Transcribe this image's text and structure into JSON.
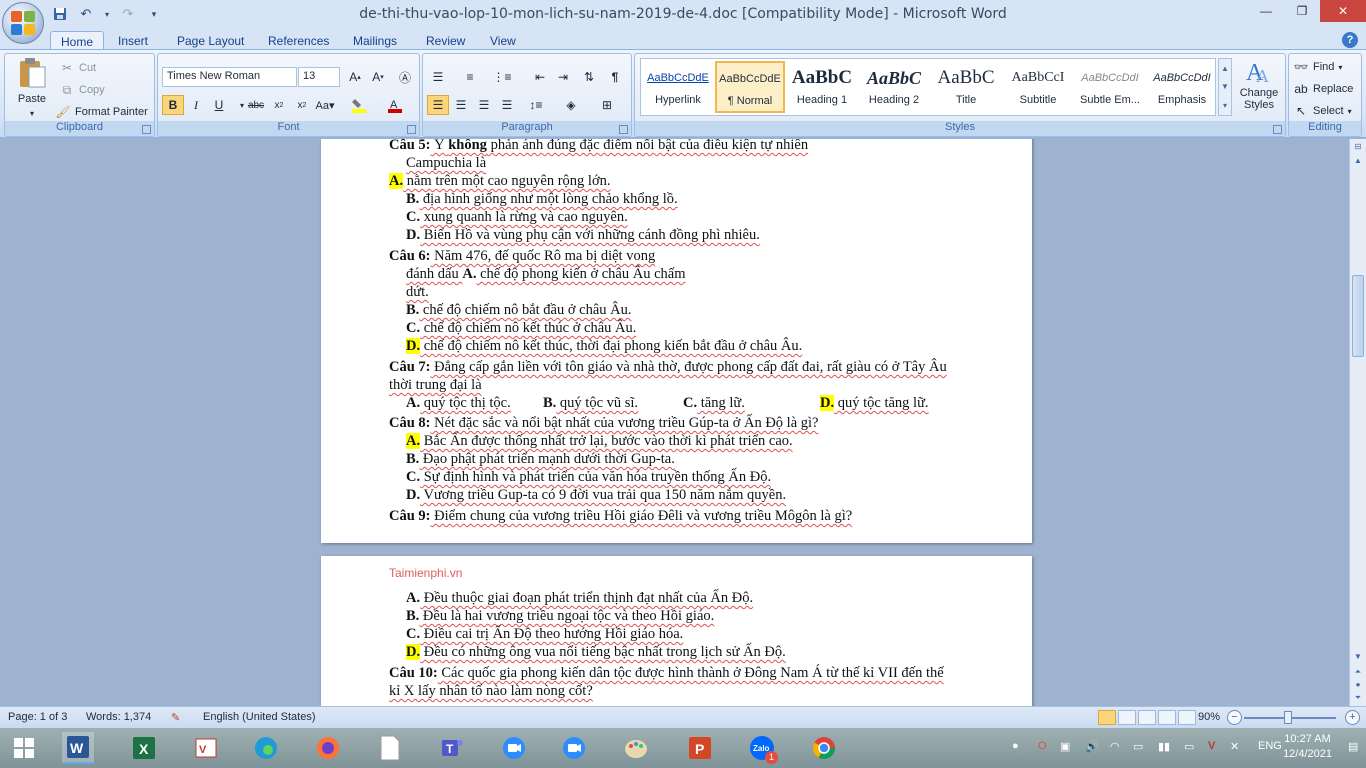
{
  "window": {
    "title": "de-thi-thu-vao-lop-10-mon-lich-su-nam-2019-de-4.doc [Compatibility Mode] - Microsoft Word"
  },
  "tabs": [
    "Home",
    "Insert",
    "Page Layout",
    "References",
    "Mailings",
    "Review",
    "View"
  ],
  "ribbon": {
    "clipboard": {
      "paste": "Paste",
      "cut": "Cut",
      "copy": "Copy",
      "format_painter": "Format Painter",
      "label": "Clipboard"
    },
    "font": {
      "name": "Times New Roman",
      "size": "13",
      "label": "Font"
    },
    "paragraph": {
      "label": "Paragraph"
    },
    "styles": {
      "label": "Styles",
      "items": [
        {
          "sample": "AaBbCcDdE",
          "name": "Hyperlink"
        },
        {
          "sample": "AaBbCcDdE",
          "name": "¶ Normal"
        },
        {
          "sample": "AaBbC",
          "name": "Heading 1"
        },
        {
          "sample": "AaBbC",
          "name": "Heading 2"
        },
        {
          "sample": "AaBbC",
          "name": "Title"
        },
        {
          "sample": "AaBbCcI",
          "name": "Subtitle"
        },
        {
          "sample": "AaBbCcDdI",
          "name": "Subtle Em..."
        },
        {
          "sample": "AaBbCcDdI",
          "name": "Emphasis"
        }
      ],
      "change_styles": "Change Styles"
    },
    "editing": {
      "find": "Find",
      "replace": "Replace",
      "select": "Select",
      "label": "Editing"
    }
  },
  "document": {
    "watermark": "Taimienphi.vn",
    "q5": {
      "num": "Câu 5:",
      "pre": " Ý ",
      "bold": "không",
      "post": " phản ánh đúng đặc điểm nổi bật của điều kiện tự nhiên",
      "line2": "Campuchia là",
      "a_lab": "A.",
      "a": " nằm trên một cao nguyên rộng lớn.",
      "b_lab": "B.",
      "b": " địa hình giống như một lòng chảo khổng lồ.",
      "c_lab": "C.",
      "c": " xung quanh là rừng và cao nguyên.",
      "d_lab": "D.",
      "d": " Biển Hồ và vùng phụ cận với những cánh đồng phì nhiêu."
    },
    "q6": {
      "num": "Câu 6:",
      "text": " Năm 476, đế quốc Rô ma bị diệt vong",
      "a_pre": "đánh dấu ",
      "a_lab": "A.",
      "a": " chế độ phong kiến ở châu Âu chấm",
      "a2": "dứt.",
      "b_lab": "B.",
      "b": " chế độ chiếm nô bắt đầu ở châu Âu.",
      "c_lab": "C.",
      "c": " chế độ chiếm nô kết thúc ở châu Âu.",
      "d_lab": "D.",
      "d": " chế độ chiếm nô kết thúc, thời đại phong kiến bắt đầu ở châu Âu."
    },
    "q7": {
      "num": "Câu 7:",
      "text": " Đẳng cấp gắn liền với tôn giáo và nhà thờ, được phong cấp đất đai, rất giàu có ở Tây Âu",
      "line2": "thời trung đại là",
      "a_lab": "A.",
      "a": " quý tộc thị tộc.",
      "b_lab": "B.",
      "b": " quý tộc vũ sĩ.",
      "c_lab": "C.",
      "c": " tăng lữ.",
      "d_lab": "D.",
      "d": " quý tộc tăng lữ."
    },
    "q8": {
      "num": "Câu 8:",
      "text": " Nét đặc sắc và nổi bật nhất của vương triều Gúp-ta ở Ấn Độ là gì?",
      "a_lab": "A.",
      "a": " Bắc Ấn được thống nhất trở lại, bước vào thời kì phát triển cao.",
      "b_lab": "B.",
      "b": " Đạo phật phát triển mạnh dưới thời Gup-ta.",
      "c_lab": "C.",
      "c": " Sự định hình và phát triển của văn hóa truyền thống Ấn Độ.",
      "d_lab": "D.",
      "d": " Vương triều Gup-ta có 9 đời vua trải qua 150 năm nắm quyền."
    },
    "q9": {
      "num": "Câu 9:",
      "text": " Điểm chung của vương triều Hồi giáo Đêli và vương triều Môgôn là gì?",
      "a_lab": "A.",
      "a": " Đều thuộc giai đoạn phát triển thịnh đạt nhất của Ấn Độ.",
      "b_lab": "B.",
      "b": " Đều là hai vương triều ngoại tộc và theo Hồi giáo.",
      "c_lab": "C.",
      "c": " Điều cai trị Ấn Độ theo hướng Hồi giáo hóa.",
      "d_lab": "D.",
      "d": " Đều có những ông vua nổi tiếng bậc nhất trong lịch sử Ấn Độ."
    },
    "q10": {
      "num": "Câu 10:",
      "text": " Các quốc gia phong kiến dân tộc được hình thành ở Đông Nam Á từ thế kỉ VII đến thế",
      "line2": "kỉ X lấy nhân tố nào làm nòng cốt?"
    }
  },
  "status": {
    "page": "Page: 1 of 3",
    "words": "Words: 1,374",
    "language": "English (United States)",
    "zoom": "90%"
  },
  "taskbar": {
    "lang": "ENG",
    "time": "10:27 AM",
    "date": "12/4/2021",
    "zalo_badge": "1"
  },
  "colors": {
    "accent": "#15428b",
    "highlight": "#ffff00",
    "ribbon": "#dfe9f7"
  }
}
